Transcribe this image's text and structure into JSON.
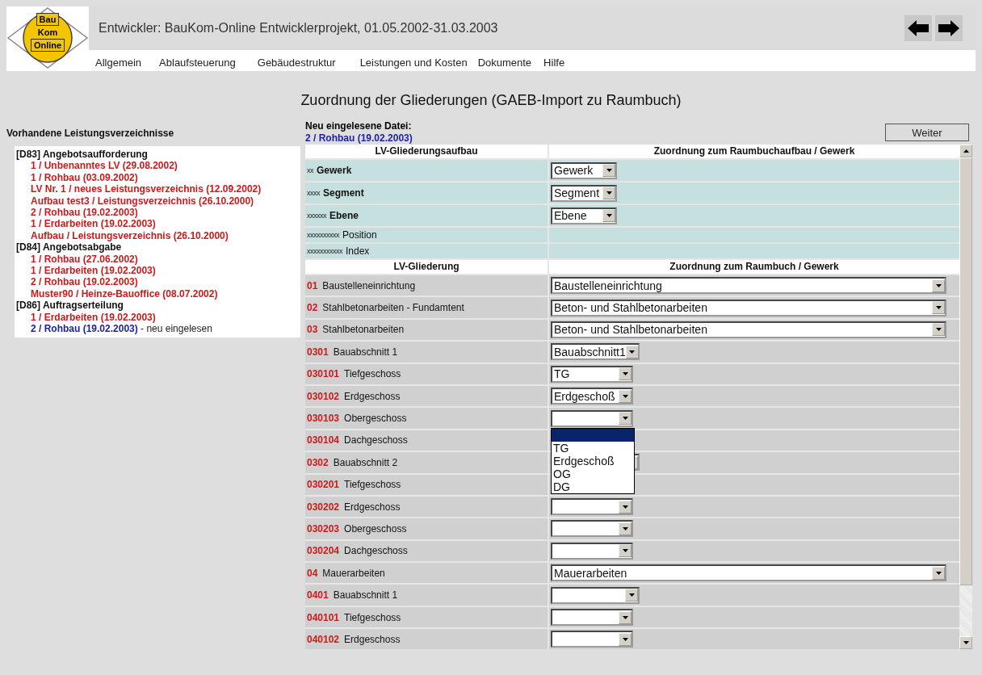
{
  "header": {
    "logo": [
      "Bau",
      "Kom",
      "Online"
    ],
    "title": "Entwickler: BauKom-Online Entwicklerprojekt, 01.05.2002-31.03.2003",
    "menu": [
      "Allgemein",
      "Ablaufsteuerung",
      "Gebäudestruktur",
      "Leistungen und Kosten",
      "Dokumente",
      "Hilfe"
    ]
  },
  "heading": "Zuordnung der Gliederungen (GAEB-Import zu Raumbuch)",
  "sidebar": {
    "title": "Vorhandene Leistungsverzeichnisse",
    "groups": [
      {
        "label": "[D83] Angebotsaufforderung",
        "items": [
          {
            "text": "1 / Unbenanntes LV (29.08.2002)",
            "selected": false
          },
          {
            "text": "1 / Rohbau (03.09.2002)",
            "selected": false
          },
          {
            "text": "LV Nr. 1 / neues Leistungsverzeichnis (12.09.2002)",
            "selected": false
          },
          {
            "text": "Aufbau test3 / Leistungsverzeichnis (26.10.2000)",
            "selected": false
          },
          {
            "text": "2 / Rohbau (19.02.2003)",
            "selected": false
          },
          {
            "text": "1 / Erdarbeiten (19.02.2003)",
            "selected": false
          },
          {
            "text": "Aufbau / Leistungsverzeichnis (26.10.2000)",
            "selected": false
          }
        ]
      },
      {
        "label": "[D84] Angebotsabgabe",
        "items": [
          {
            "text": "1 / Rohbau (27.06.2002)",
            "selected": false
          },
          {
            "text": "1 / Erdarbeiten (19.02.2003)",
            "selected": false
          },
          {
            "text": "2 / Rohbau (19.02.2003)",
            "selected": false
          },
          {
            "text": "Muster90 / Heinze-Bauoffice (08.07.2002)",
            "selected": false
          }
        ]
      },
      {
        "label": "[D86] Auftragserteilung",
        "items": [
          {
            "text": "1 / Erdarbeiten (19.02.2003)",
            "selected": false
          },
          {
            "text": "2 / Rohbau (19.02.2003)",
            "selected": true,
            "note": "- neu eingelesen"
          }
        ]
      }
    ]
  },
  "import": {
    "label": "Neu eingelesene Datei:",
    "file": "2 / Rohbau (19.02.2003)",
    "button": "Weiter"
  },
  "structure": {
    "columns": [
      "LV-Gliederungsaufbau",
      "Zuordnung zum Raumbuchaufbau / Gewerk"
    ],
    "rows": [
      {
        "mask": "xx",
        "name": "Gewerk",
        "bold": true,
        "select": "Gewerk"
      },
      {
        "mask": "xxxx",
        "name": "Segment",
        "bold": true,
        "select": "Segment"
      },
      {
        "mask": "xxxxxx",
        "name": "Ebene",
        "bold": true,
        "select": "Ebene"
      },
      {
        "mask": "xxxxxxxxxx",
        "name": "Position",
        "bold": false
      },
      {
        "mask": "xxxxxxxxxxx",
        "name": "Index",
        "bold": false
      }
    ]
  },
  "mapping": {
    "columns": [
      "LV-Gliederung",
      "Zuordnung zum Raumbuch / Gewerk"
    ],
    "rows": [
      {
        "code": "01",
        "name": "Baustelleneinrichtung",
        "select": {
          "kind": "wide",
          "value": "Baustelleneinrichtung"
        }
      },
      {
        "code": "02",
        "name": "Stahlbetonarbeiten - Fundamtent",
        "select": {
          "kind": "wide",
          "value": "Beton- und Stahlbetonarbeiten"
        }
      },
      {
        "code": "03",
        "name": "Stahlbetonarbeiten",
        "select": {
          "kind": "wide",
          "value": "Beton- und Stahlbetonarbeiten"
        }
      },
      {
        "code": "0301",
        "name": "Bauabschnitt 1",
        "select": {
          "kind": "medium",
          "value": "Bauabschnitt1"
        }
      },
      {
        "code": "030101",
        "name": "Tiefgeschoss",
        "select": {
          "kind": "small",
          "value": "TG"
        }
      },
      {
        "code": "030102",
        "name": "Erdgeschoss",
        "select": {
          "kind": "small",
          "value": "Erdgeschoß"
        }
      },
      {
        "code": "030103",
        "name": "Obergeschoss",
        "select": {
          "kind": "small",
          "open": true,
          "options": [
            {
              "selected": true
            },
            {
              "text": "TG",
              "selected": false
            },
            {
              "text": "Erdgeschoß",
              "selected": false
            },
            {
              "text": "OG",
              "selected": false
            },
            {
              "text": "DG",
              "selected": false
            }
          ]
        }
      },
      {
        "code": "030104",
        "name": "Dachgeschoss"
      },
      {
        "code": "0302",
        "name": "Bauabschnitt 2",
        "select": {
          "kind": "medium"
        }
      },
      {
        "code": "030201",
        "name": "Tiefgeschoss"
      },
      {
        "code": "030202",
        "name": "Erdgeschoss",
        "select": {
          "kind": "small"
        }
      },
      {
        "code": "030203",
        "name": "Obergeschoss",
        "select": {
          "kind": "small"
        }
      },
      {
        "code": "030204",
        "name": "Dachgeschoss",
        "select": {
          "kind": "small"
        }
      },
      {
        "code": "04",
        "name": "Mauerarbeiten",
        "select": {
          "kind": "wide",
          "value": "Mauerarbeiten"
        }
      },
      {
        "code": "0401",
        "name": "Bauabschnitt 1",
        "select": {
          "kind": "medium"
        }
      },
      {
        "code": "040101",
        "name": "Tiefgeschoss",
        "select": {
          "kind": "small"
        }
      },
      {
        "code": "040102",
        "name": "Erdgeschoss",
        "select": {
          "kind": "small"
        }
      }
    ]
  }
}
